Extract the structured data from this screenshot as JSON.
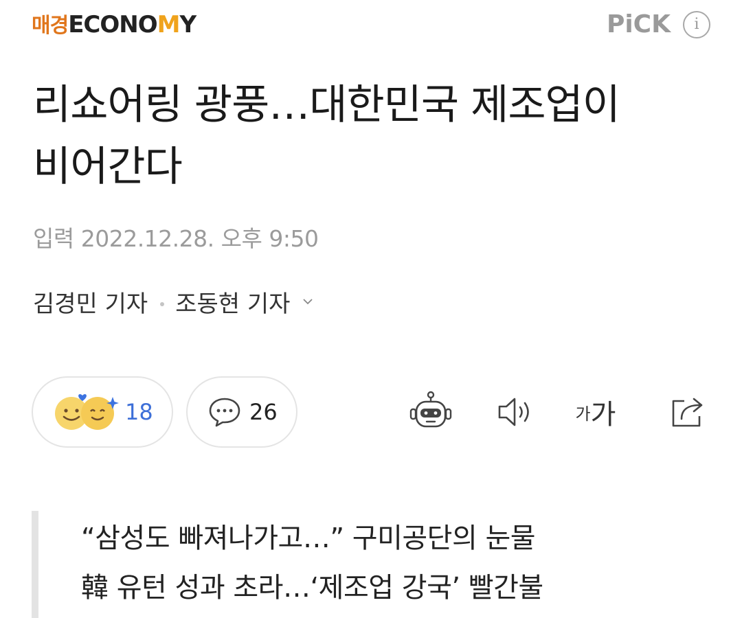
{
  "header": {
    "logo_kr": "매경",
    "logo_en_main": "ECONO",
    "logo_en_accent": "M",
    "logo_en_tail": "Y",
    "pick_label": "PiCK",
    "info_label": "i"
  },
  "article": {
    "title": "리쇼어링 광풍…대한민국 제조업이 비어간다",
    "timestamp": "입력 2022.12.28. 오후 9:50",
    "authors": [
      "김경민 기자",
      "조동현 기자"
    ]
  },
  "actions": {
    "reaction_count": "18",
    "comment_count": "26",
    "font_small": "가",
    "font_large": "가"
  },
  "summary": {
    "lines": [
      "“삼성도 빠져나가고…” 구미공단의 눈물",
      "韓 유턴 성과 초라…‘제조업 강국’ 빨간불"
    ]
  },
  "colors": {
    "logo_orange": "#e0761c",
    "reaction_blue": "#3d6fd8",
    "muted_gray": "#9b9b9b"
  },
  "icons": [
    "info-icon",
    "chevron-down-icon",
    "smile-face-icon",
    "heart-icon",
    "sparkle-icon",
    "comment-icon",
    "robot-icon",
    "speaker-icon",
    "share-icon"
  ]
}
